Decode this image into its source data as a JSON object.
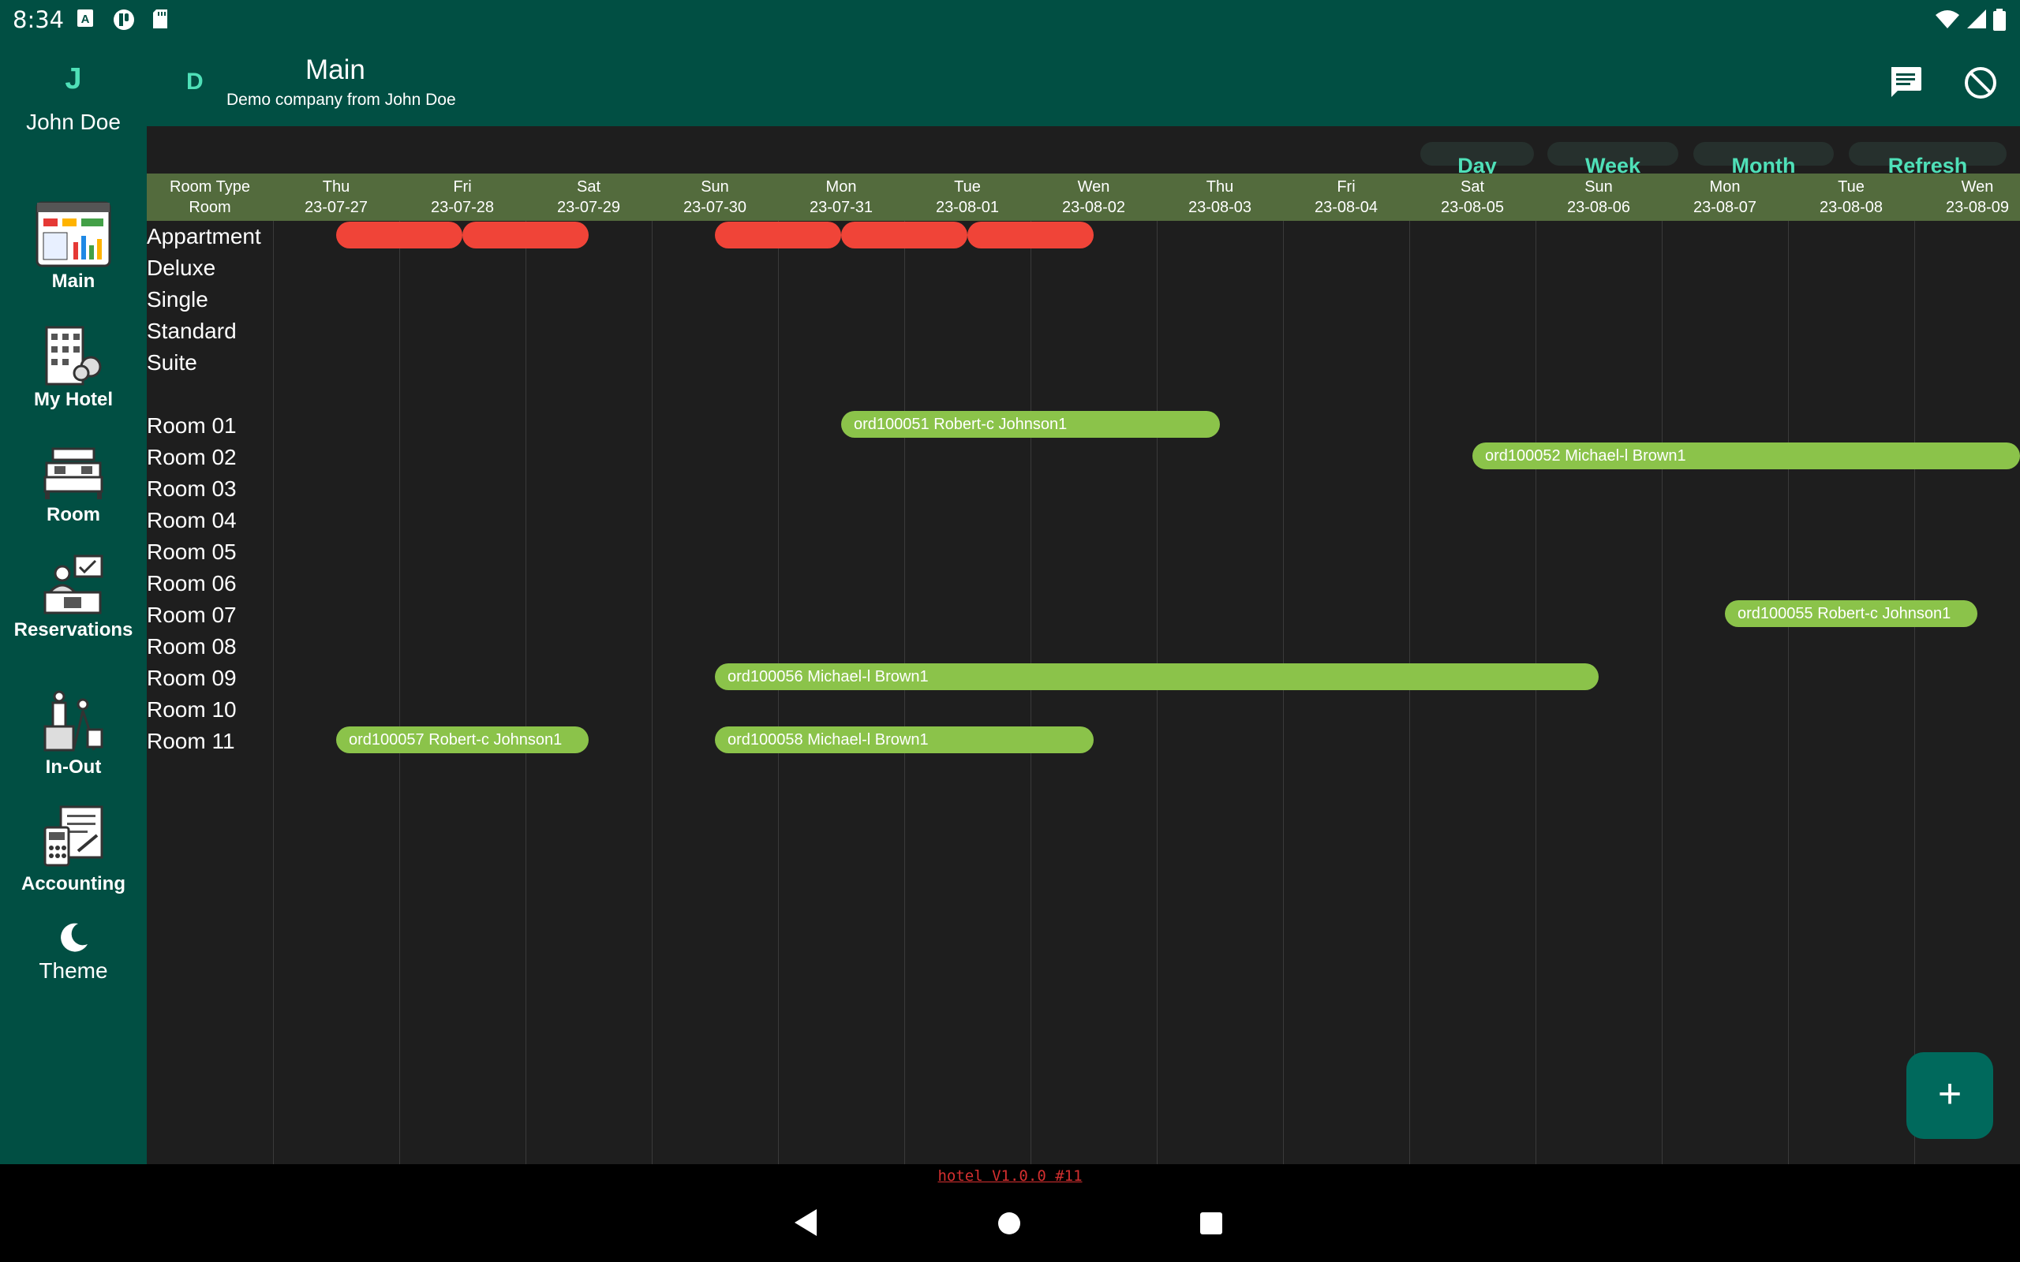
{
  "status_bar": {
    "time": "8:34"
  },
  "user": {
    "initial": "J",
    "name": "John Doe"
  },
  "sidebar": {
    "items": [
      {
        "label": "Main"
      },
      {
        "label": "My Hotel"
      },
      {
        "label": "Room"
      },
      {
        "label": "Reservations"
      },
      {
        "label": "In-Out"
      },
      {
        "label": "Accounting"
      },
      {
        "label": "Theme"
      }
    ]
  },
  "app_bar": {
    "company_initial": "D",
    "title": "Main",
    "subtitle": "Demo company from John Doe"
  },
  "view_buttons": {
    "day": "Day",
    "week": "Week",
    "month": "Month",
    "refresh": "Refresh"
  },
  "grid": {
    "header_top": "Room Type",
    "header_bottom": "Room",
    "days": [
      {
        "dow": "Thu",
        "date": "23-07-27"
      },
      {
        "dow": "Fri",
        "date": "23-07-28"
      },
      {
        "dow": "Sat",
        "date": "23-07-29"
      },
      {
        "dow": "Sun",
        "date": "23-07-30"
      },
      {
        "dow": "Mon",
        "date": "23-07-31"
      },
      {
        "dow": "Tue",
        "date": "23-08-01"
      },
      {
        "dow": "Wen",
        "date": "23-08-02"
      },
      {
        "dow": "Thu",
        "date": "23-08-03"
      },
      {
        "dow": "Fri",
        "date": "23-08-04"
      },
      {
        "dow": "Sat",
        "date": "23-08-05"
      },
      {
        "dow": "Sun",
        "date": "23-08-06"
      },
      {
        "dow": "Mon",
        "date": "23-08-07"
      },
      {
        "dow": "Tue",
        "date": "23-08-08"
      },
      {
        "dow": "Wen",
        "date": "23-08-09"
      }
    ],
    "room_types": [
      "Appartment",
      "Deluxe",
      "Single",
      "Standard",
      "Suite"
    ],
    "rooms": [
      "Room 01",
      "Room 02",
      "Room 03",
      "Room 04",
      "Room 05",
      "Room 06",
      "Room 07",
      "Room 08",
      "Room 09",
      "Room 10",
      "Room 11"
    ]
  },
  "type_blocks": [
    {
      "room_type": "Appartment",
      "start_day": 0.5,
      "end_day": 1.5
    },
    {
      "room_type": "Appartment",
      "start_day": 1.5,
      "end_day": 2.5
    },
    {
      "room_type": "Appartment",
      "start_day": 3.5,
      "end_day": 4.5
    },
    {
      "room_type": "Appartment",
      "start_day": 4.5,
      "end_day": 5.5
    },
    {
      "room_type": "Appartment",
      "start_day": 5.5,
      "end_day": 6.5
    }
  ],
  "reservations": [
    {
      "room": "Room 01",
      "order": "ord100051",
      "guest": "Robert-c Johnson1",
      "text": "ord100051  Robert-c Johnson1",
      "start_day": 4.5,
      "end_day": 7.5
    },
    {
      "room": "Room 02",
      "order": "ord100052",
      "guest": "Michael-l Brown1",
      "text": "ord100052  Michael-l Brown1",
      "start_day": 9.5,
      "end_day": 14.0
    },
    {
      "room": "Room 07",
      "order": "ord100055",
      "guest": "Robert-c Johnson1",
      "text": "ord100055  Robert-c Johnson1",
      "start_day": 11.5,
      "end_day": 13.5
    },
    {
      "room": "Room 09",
      "order": "ord100056",
      "guest": "Michael-l Brown1",
      "text": "ord100056  Michael-l Brown1",
      "start_day": 3.5,
      "end_day": 10.5
    },
    {
      "room": "Room 11",
      "order": "ord100057",
      "guest": "Robert-c Johnson1",
      "text": "ord100057  Robert-c Johnson1",
      "start_day": 0.5,
      "end_day": 2.5
    },
    {
      "room": "Room 11",
      "order": "ord100058",
      "guest": "Michael-l Brown1",
      "text": "ord100058  Michael-l Brown1",
      "start_day": 3.5,
      "end_day": 6.5
    }
  ],
  "fab": {
    "label": "+"
  },
  "version": "hotel V1.0.0 #11",
  "colors": {
    "primary": "#014f43",
    "accent": "#4fe0b8",
    "grid_bg": "#1e1e1e",
    "header_bg": "#536b3d",
    "blocked": "#f04438",
    "reservation": "#8bc34a",
    "version_link": "#d32f2f"
  }
}
